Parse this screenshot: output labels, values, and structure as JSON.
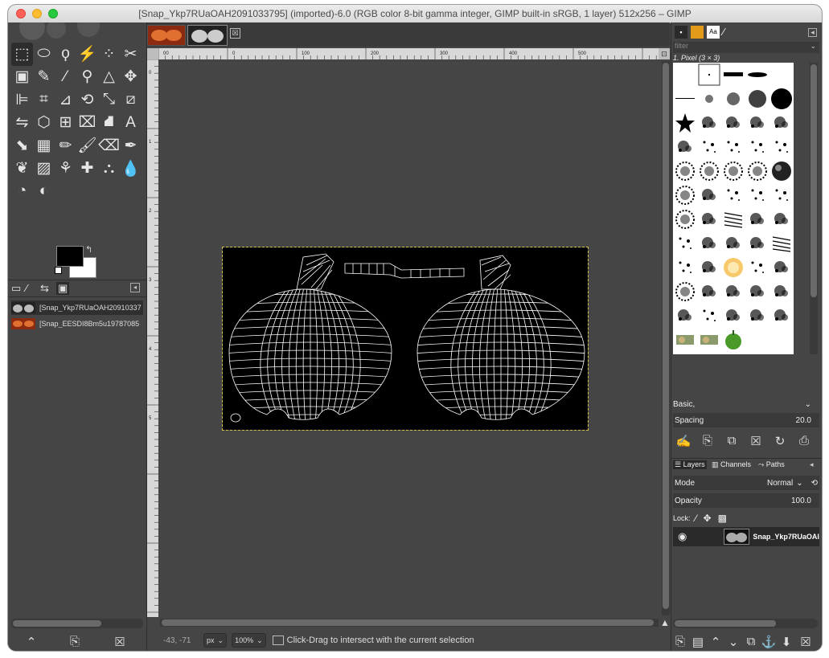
{
  "window": {
    "title": "[Snap_Ykp7RUaOAH2091033795] (imported)-6.0 (RGB color 8-bit gamma integer, GIMP built-in sRGB, 1 layer) 512x256 – GIMP"
  },
  "toolbox": {
    "tools": [
      {
        "name": "rect-select-icon",
        "glyph": "⬚"
      },
      {
        "name": "ellipse-select-icon",
        "glyph": "⬭"
      },
      {
        "name": "free-select-icon",
        "glyph": "ϙ"
      },
      {
        "name": "fuzzy-select-icon",
        "glyph": "⚡"
      },
      {
        "name": "select-by-color-icon",
        "glyph": "⁘"
      },
      {
        "name": "scissors-select-icon",
        "glyph": "✂"
      },
      {
        "name": "foreground-select-icon",
        "glyph": "▣"
      },
      {
        "name": "paths-tool-icon",
        "glyph": "✎"
      },
      {
        "name": "color-picker-icon",
        "glyph": "⁄"
      },
      {
        "name": "zoom-icon",
        "glyph": "⚲"
      },
      {
        "name": "measure-icon",
        "glyph": "△"
      },
      {
        "name": "move-icon",
        "glyph": "✥"
      },
      {
        "name": "align-icon",
        "glyph": "⊫"
      },
      {
        "name": "crop-icon",
        "glyph": "⌗"
      },
      {
        "name": "unified-transform-icon",
        "glyph": "⊿"
      },
      {
        "name": "rotate-icon",
        "glyph": "⟲"
      },
      {
        "name": "scale-icon",
        "glyph": "⤡"
      },
      {
        "name": "shear-icon",
        "glyph": "⧄"
      },
      {
        "name": "flip-icon",
        "glyph": "⇋"
      },
      {
        "name": "perspective-3d-icon",
        "glyph": "⬡"
      },
      {
        "name": "warp-icon",
        "glyph": "⊞"
      },
      {
        "name": "cage-icon",
        "glyph": "⌧"
      },
      {
        "name": "bucket-fill-icon",
        "glyph": "⛘"
      },
      {
        "name": "text-icon",
        "glyph": "A"
      },
      {
        "name": "gradient-icon",
        "glyph": "⬊"
      },
      {
        "name": "blend-icon",
        "glyph": "▦"
      },
      {
        "name": "pencil-icon",
        "glyph": "✏"
      },
      {
        "name": "paintbrush-icon",
        "glyph": "🖌"
      },
      {
        "name": "eraser-icon",
        "glyph": "⌫"
      },
      {
        "name": "airbrush-icon",
        "glyph": "✒"
      },
      {
        "name": "ink-icon",
        "glyph": "❦"
      },
      {
        "name": "mypaint-brush-icon",
        "glyph": "▨"
      },
      {
        "name": "clone-icon",
        "glyph": "⚘"
      },
      {
        "name": "heal-icon",
        "glyph": "✚"
      },
      {
        "name": "perspective-clone-icon",
        "glyph": "⛬"
      },
      {
        "name": "smudge-icon",
        "glyph": "💧"
      },
      {
        "name": "blur-icon",
        "glyph": "◔"
      },
      {
        "name": "dodge-burn-icon",
        "glyph": "◐"
      }
    ],
    "images_tab": {
      "items": [
        {
          "label": "[Snap_Ykp7RUaOAH20910337"
        },
        {
          "label": "[Snap_EESDI8Bm5u19787085"
        }
      ]
    }
  },
  "canvas": {
    "ruler_ticks": [
      "00",
      "0",
      "100",
      "200",
      "300",
      "400",
      "500"
    ],
    "ruler_left_ticks": [
      "0",
      "1",
      "2",
      "3",
      "4",
      "5"
    ],
    "tab_close": "☒"
  },
  "status": {
    "coords": "-43, -71",
    "unit": "px",
    "zoom": "100%",
    "message": "Click-Drag to intersect with the current selection"
  },
  "brushes": {
    "filter_placeholder": "filter",
    "current": "1. Pixel (3 × 3)",
    "preset": "Basic,",
    "spacing_label": "Spacing",
    "spacing_value": "20.0"
  },
  "layers": {
    "tabs": {
      "layers": "Layers",
      "channels": "Channels",
      "paths": "Paths"
    },
    "mode_label": "Mode",
    "mode_value": "Normal",
    "opacity_label": "Opacity",
    "opacity_value": "100.0",
    "lock_label": "Lock:",
    "layer_name": "Snap_Ykp7RUaOAI"
  },
  "colors": {
    "foreground": "#000000",
    "background": "#ffffff",
    "canvas_bg": "#454545",
    "wireframe": "#ffffff"
  }
}
